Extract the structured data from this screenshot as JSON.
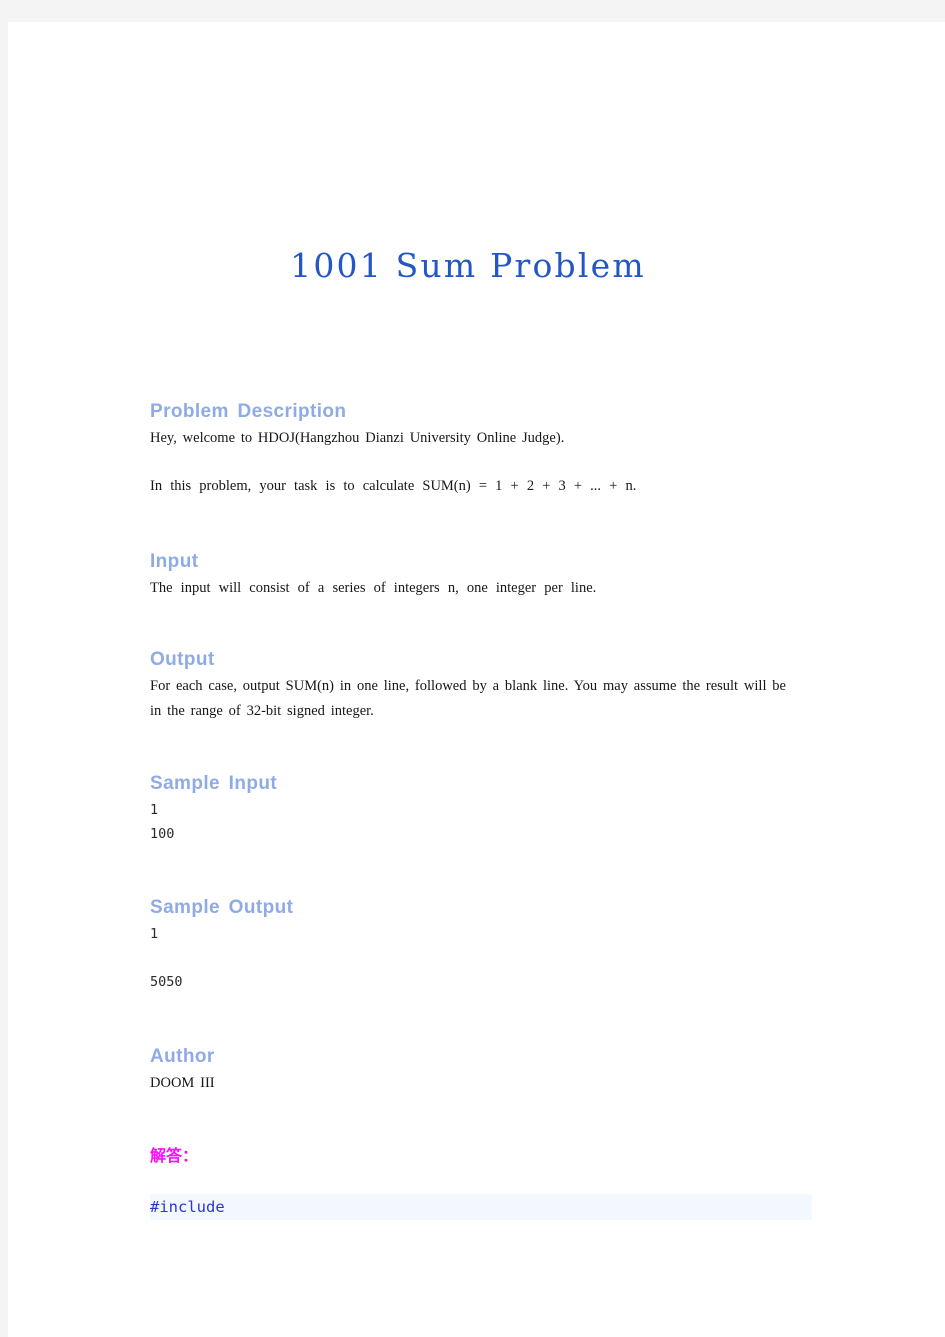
{
  "document": {
    "title": "1001 Sum Problem",
    "title_color": "#2457c5",
    "heading_color": "#8fabe6",
    "body_color": "#171717",
    "note_color": "#fa0ffa",
    "code_color": "#2b35d8",
    "code_highlight_color": "#f2f8fe"
  },
  "sections": {
    "problem_description": {
      "heading": "Problem Description",
      "paragraph_1": "Hey, welcome to HDOJ(Hangzhou Dianzi University Online Judge).",
      "paragraph_2": "In this problem, your task is to calculate SUM(n) = 1 + 2 + 3 + ... + n."
    },
    "input": {
      "heading": "Input",
      "paragraph_1": "The input will consist of a series of integers n, one integer per line."
    },
    "output": {
      "heading": "Output",
      "paragraph_1": "For each case, output SUM(n) in one line, followed by a blank line. You may assume the result will be in the range of 32-bit signed integer."
    },
    "sample_input": {
      "heading": "Sample Input",
      "content": "1\n100"
    },
    "sample_output": {
      "heading": "Sample Output",
      "content": "1\n\n5050"
    },
    "author": {
      "heading": "Author",
      "name": "DOOM  III"
    },
    "solution": {
      "label": "解答：",
      "code": "#include"
    }
  }
}
